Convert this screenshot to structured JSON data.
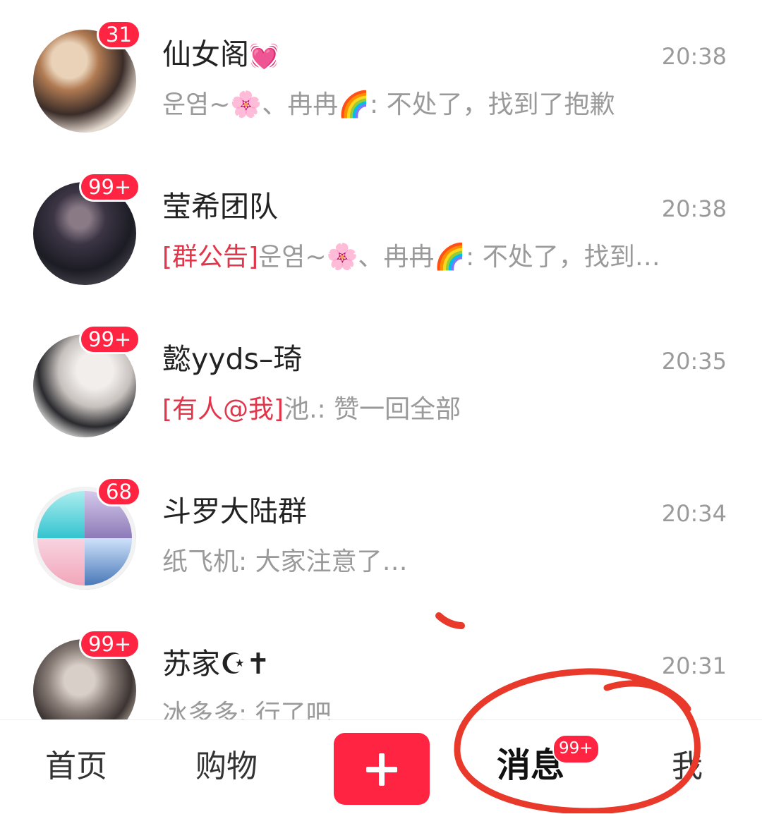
{
  "chats": [
    {
      "name": "仙女阁",
      "name_emoji": "💓",
      "badge": "31",
      "time": "20:38",
      "tag": "",
      "preview": "운염~🌸、冉冉🌈: 不处了，找到了抱歉"
    },
    {
      "name": "莹希团队",
      "name_emoji": "",
      "badge": "99+",
      "time": "20:38",
      "tag": "[群公告]",
      "preview": "운염~🌸、冉冉🌈: 不处了，找到…"
    },
    {
      "name": "懿yyds–琦",
      "name_emoji": "",
      "badge": "99+",
      "time": "20:35",
      "tag": "[有人@我]",
      "preview": "池.: 赞一回全部"
    },
    {
      "name": "斗罗大陆群",
      "name_emoji": "",
      "badge": "68",
      "time": "20:34",
      "tag": "",
      "preview": "纸飞机: 大家注意了…"
    },
    {
      "name": "苏家☪✝",
      "name_emoji": "",
      "badge": "99+",
      "time": "20:31",
      "tag": "",
      "preview": "冰多多: 行了吧"
    }
  ],
  "nav": {
    "home": "首页",
    "shop": "购物",
    "messages": "消息",
    "messages_badge": "99+",
    "me": "我"
  },
  "colors": {
    "accent": "#ff2442",
    "annotation": "#e8392a"
  }
}
